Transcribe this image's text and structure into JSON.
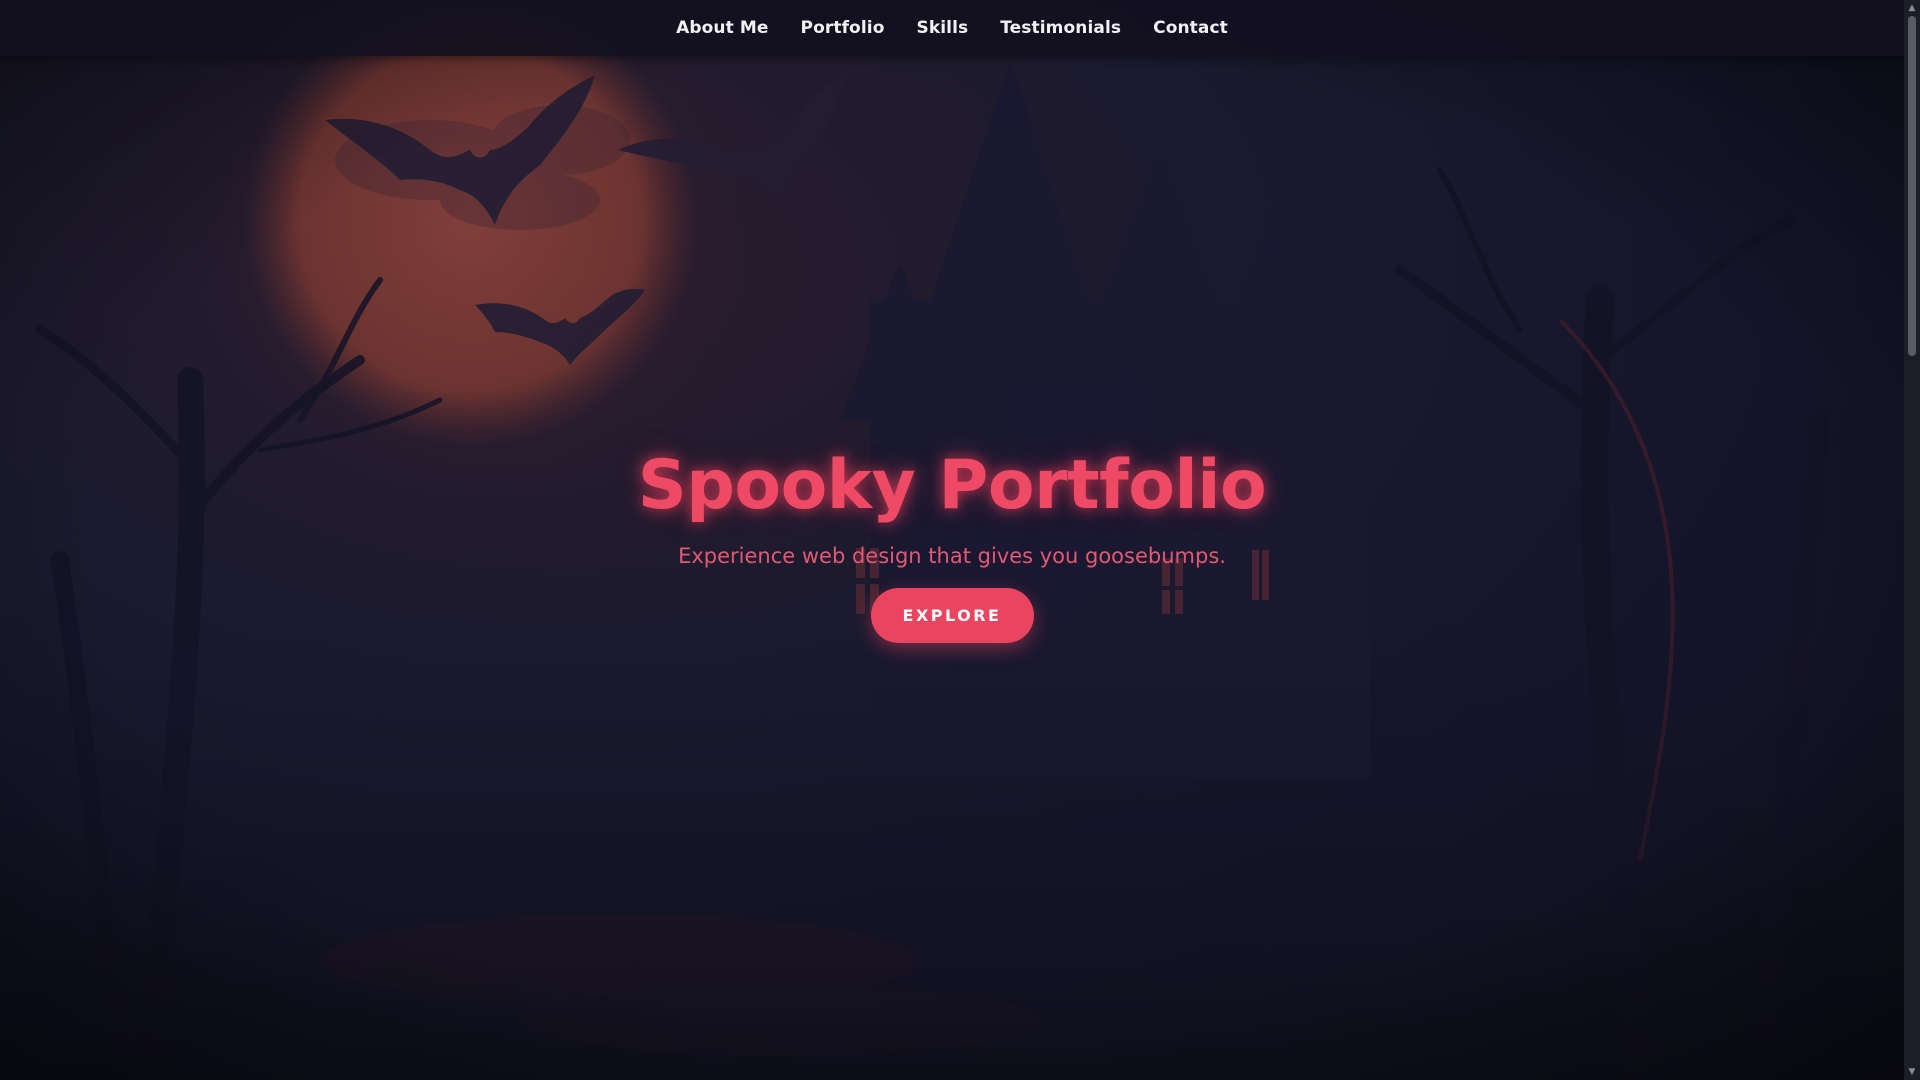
{
  "nav": {
    "items": [
      {
        "label": "About Me"
      },
      {
        "label": "Portfolio"
      },
      {
        "label": "Skills"
      },
      {
        "label": "Testimonials"
      },
      {
        "label": "Contact"
      }
    ]
  },
  "hero": {
    "title": "Spooky Portfolio",
    "subtitle": "Experience web design that gives you goosebumps.",
    "cta_label": "EXPLORE"
  },
  "background": {
    "elements": [
      "full-moon",
      "bat-icon",
      "haunted-castle",
      "bare-trees",
      "forest-path"
    ]
  },
  "colors": {
    "accent": "#e94560",
    "background": "#15152a",
    "nav_background": "#12101f",
    "nav_text": "#f1f1f4",
    "moon": "#7c3a33"
  },
  "scrollbar": {
    "position_fraction": 0
  }
}
